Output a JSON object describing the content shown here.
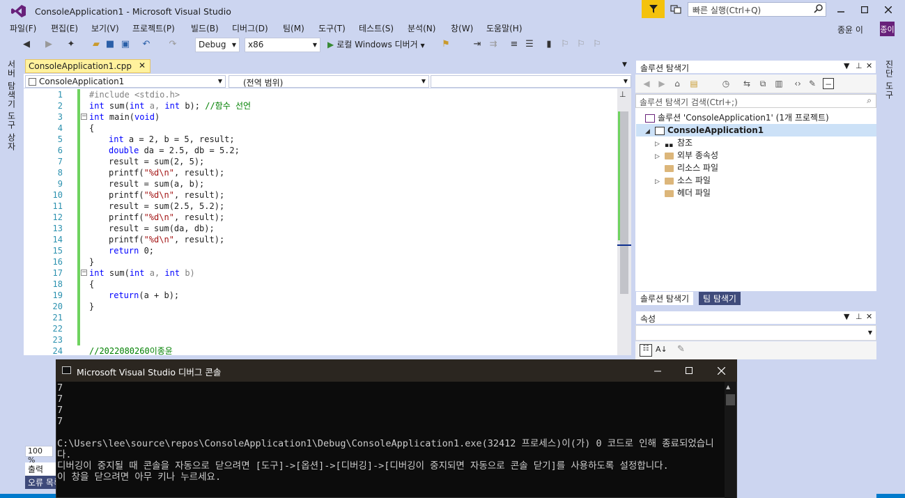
{
  "window": {
    "title": "ConsoleApplication1 - Microsoft Visual Studio",
    "quick_launch_placeholder": "빠른 실행(Ctrl+Q)",
    "user_name": "종윤 이",
    "user_initials": "종이"
  },
  "menu": [
    "파일(F)",
    "편집(E)",
    "보기(V)",
    "프로젝트(P)",
    "빌드(B)",
    "디버그(D)",
    "팀(M)",
    "도구(T)",
    "테스트(S)",
    "분석(N)",
    "창(W)",
    "도움말(H)"
  ],
  "toolbar": {
    "config": "Debug",
    "platform": "x86",
    "run_label": "로컬 Windows 디버거"
  },
  "left_tabs": [
    "서버 탐색기",
    "도구 상자"
  ],
  "right_tabs": [
    "진단 도구"
  ],
  "editor": {
    "tab_label": "ConsoleApplication1.cpp",
    "nav_project": "ConsoleApplication1",
    "nav_scope": "(전역 범위)",
    "zoom": "100 %",
    "line_numbers": [
      "1",
      "2",
      "3",
      "4",
      "5",
      "6",
      "7",
      "8",
      "9",
      "10",
      "11",
      "12",
      "13",
      "14",
      "15",
      "16",
      "17",
      "18",
      "19",
      "20",
      "21",
      "22",
      "23",
      "24"
    ],
    "code": {
      "l1": "#include <stdio.h>",
      "l2a": "int",
      "l2b": " sum(",
      "l2c": "int",
      "l2d": " a, ",
      "l2e": "int",
      "l2f": " b); ",
      "l2g": "//함수 선언",
      "l3a": "int",
      "l3b": " main(",
      "l3c": "void",
      "l3d": ")",
      "l4": "{",
      "l5a": "int",
      "l5b": " a = 2, b = 5, result;",
      "l6a": "double",
      "l6b": " da = 2.5, db = 5.2;",
      "l7": "result = sum(2, 5);",
      "l8a": "printf(",
      "l8b": "\"%d\\n\"",
      "l8c": ", result);",
      "l9": "result = sum(a, b);",
      "l10a": "printf(",
      "l10b": "\"%d\\n\"",
      "l10c": ", result);",
      "l11": "result = sum(2.5, 5.2);",
      "l12a": "printf(",
      "l12b": "\"%d\\n\"",
      "l12c": ", result);",
      "l13": "result = sum(da, db);",
      "l14a": "printf(",
      "l14b": "\"%d\\n\"",
      "l14c": ", result);",
      "l15a": "return",
      "l15b": " 0;",
      "l16": "}",
      "l17a": "int",
      "l17b": " sum(",
      "l17c": "int",
      "l17d": " a, ",
      "l17e": "int",
      "l17f": " b)",
      "l18": "{",
      "l19a": "return",
      "l19b": "(a + b);",
      "l20": "}",
      "l24": "//2022080260이종윤"
    }
  },
  "bottom_tabs": [
    "출력",
    "오류 목록"
  ],
  "solution_explorer": {
    "title": "솔루션 탐색기",
    "search_placeholder": "솔루션 탐색기 검색(Ctrl+;)",
    "solution_label": "솔루션 'ConsoleApplication1' (1개 프로젝트)",
    "project_label": "ConsoleApplication1",
    "nodes": [
      "참조",
      "외부 종속성",
      "리소스 파일",
      "소스 파일",
      "헤더 파일"
    ],
    "tab_active": "솔루션 탐색기",
    "tab_inactive": "팀 탐색기"
  },
  "properties": {
    "title": "속성"
  },
  "console": {
    "title": "Microsoft Visual Studio 디버그 콘솔",
    "output": "7\n7\n7\n7\n\nC:\\Users\\lee\\source\\repos\\ConsoleApplication1\\Debug\\ConsoleApplication1.exe(32412 프로세스)이(가) 0 코드로 인해 종료되었습니다.\n디버깅이 중지될 때 콘솔을 자동으로 닫으려면 [도구]->[옵션]->[디버깅]->[디버깅이 중지되면 자동으로 콘솔 닫기]를 사용하도록 설정합니다.\n이 창을 닫으려면 아무 키나 누르세요."
  },
  "colors": {
    "chrome": "#ccd5f0",
    "accent": "#68217a",
    "notification": "#f4c20d",
    "change_bar": "#6fd35f",
    "console_bg": "#0c0c0c"
  }
}
